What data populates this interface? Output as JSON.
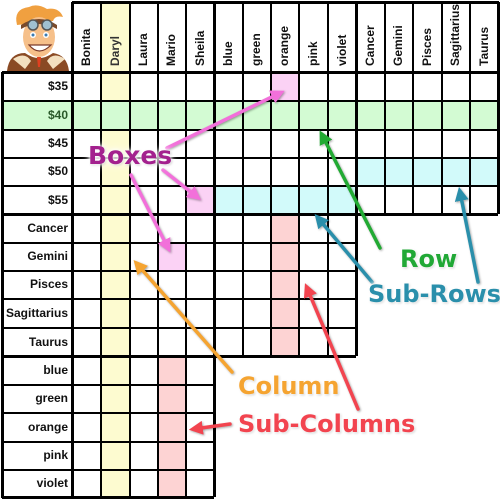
{
  "header_columns": {
    "names": [
      "Bonita",
      "Daryl",
      "Laura",
      "Mario",
      "Sheila"
    ],
    "colors": [
      "blue",
      "green",
      "orange",
      "pink",
      "violet"
    ],
    "signs": [
      "Cancer",
      "Gemini",
      "Pisces",
      "Sagittarius",
      "Taurus"
    ]
  },
  "row_groups": {
    "prices": [
      "$35",
      "$40",
      "$45",
      "$50",
      "$55"
    ],
    "signs": [
      "Cancer",
      "Gemini",
      "Pisces",
      "Sagittarius",
      "Taurus"
    ],
    "colors": [
      "blue",
      "green",
      "orange",
      "pink",
      "violet"
    ]
  },
  "avatar": {
    "icon": "cartoon-pilot-character"
  },
  "highlights": {
    "column": {
      "group": "names",
      "label": "Daryl",
      "color": "#fdfbd0"
    },
    "row": {
      "group": "prices",
      "label": "$40",
      "color": "#d3fbd3"
    },
    "sub_rows": [
      {
        "row": "$50",
        "column_group": "signs",
        "color": "#d2fafa"
      },
      {
        "row": "$55",
        "column_group": "colors",
        "color": "#d2fafa"
      }
    ],
    "sub_columns": [
      {
        "column": "orange",
        "row_group": "signs",
        "color": "#fdd3d3"
      },
      {
        "column": "Mario",
        "row_group": "colors",
        "color": "#fdd3d3"
      }
    ],
    "boxes": [
      {
        "row": "$35",
        "column": "orange",
        "color": "#fbd2f5"
      },
      {
        "row": "$55",
        "column": "Sheila",
        "color": "#fbd2f5"
      },
      {
        "row": "Gemini",
        "column": "Mario",
        "color": "#fbd2f5"
      }
    ]
  },
  "callouts": {
    "boxes": {
      "text": "Boxes",
      "color": "#a3218e",
      "arrow_color": "#f270da"
    },
    "row": {
      "text": "Row",
      "color": "#21a836",
      "arrow_color": "#22aa33"
    },
    "sub_rows": {
      "text": "Sub-Rows",
      "color": "#2a8fab",
      "arrow_color": "#2a8fab"
    },
    "column": {
      "text": "Column",
      "color": "#f5a431",
      "arrow_color": "#f5a431"
    },
    "sub_columns": {
      "text": "Sub-Columns",
      "color": "#f2444f",
      "arrow_color": "#f2444f"
    }
  }
}
